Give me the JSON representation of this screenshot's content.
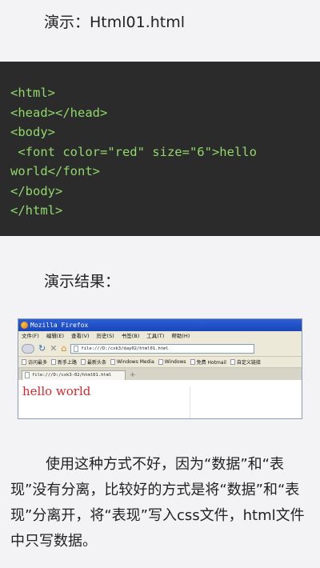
{
  "heading_demo": "演示：Html01.html",
  "code_lines": [
    "<html>",
    "<head></head>",
    "<body>",
    " <font color=\"red\" size=\"6\">hello",
    "world</font>",
    "</body>",
    "</html>"
  ],
  "heading_result": "演示结果：",
  "browser": {
    "title": "Mozilla Firefox",
    "menu": [
      "文件(F)",
      "编辑(E)",
      "查看(V)",
      "历史(S)",
      "书签(B)",
      "工具(T)",
      "帮助(H)"
    ],
    "url": "file:///D:/cxk3/day02/html01.html",
    "bookmarks": [
      "访问最多",
      "新手上路",
      "最新头条",
      "Windows Media",
      "Windows",
      "免费 Hotmail",
      "自定义链接"
    ],
    "tab_label": "file:///D:/cxk3-02/html01.html",
    "page_text": "hello world",
    "colors": {
      "titlebar": "#1f4fc8",
      "page_text": "#d8262d"
    }
  },
  "paragraph": "使用这种方式不好，因为“数据”和“表现”没有分离，比较好的方式是将“数据”和“表现”分离开，将“表现”写入css文件，html文件中只写数据。",
  "colors": {
    "code_bg": "#2b2b2b",
    "code_text": "#8fd86a",
    "page_bg": "#f3f3f5"
  }
}
